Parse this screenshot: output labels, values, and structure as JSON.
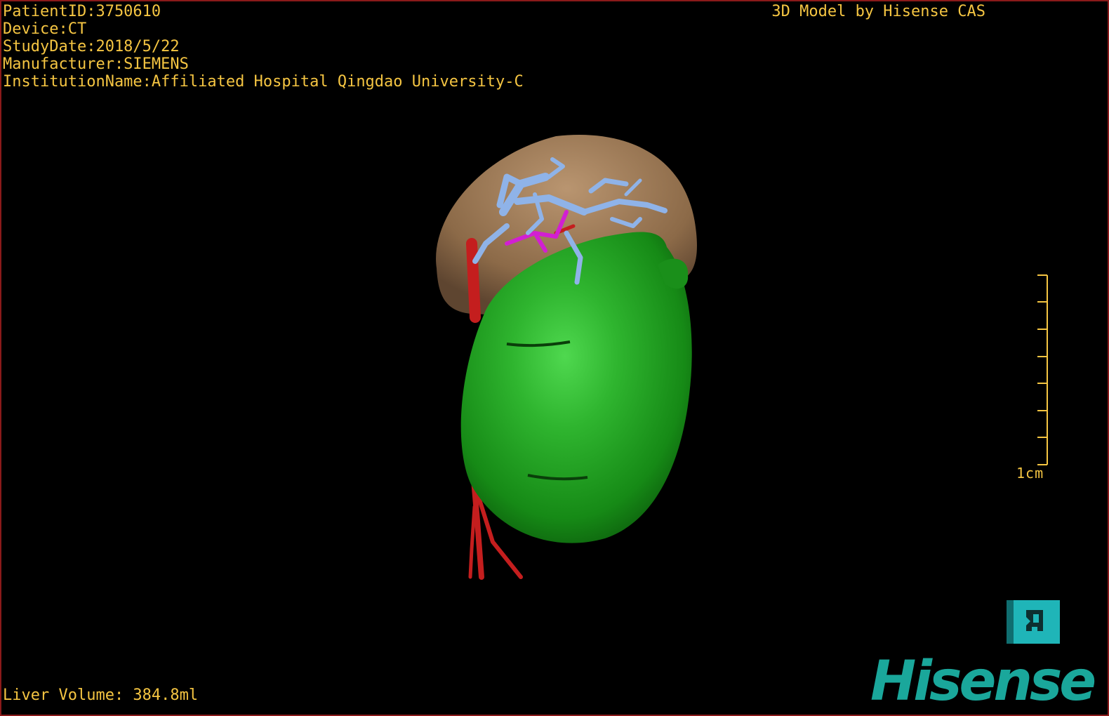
{
  "info": {
    "patient_id": "PatientID:3750610",
    "device": "Device:CT",
    "study_date": "StudyDate:2018/5/22",
    "manufacturer": "Manufacturer:SIEMENS",
    "institution": "InstitutionName:Affiliated Hospital Qingdao University-C"
  },
  "model_credit": "3D Model by Hisense CAS",
  "volume_readout": "Liver Volume: 384.8ml",
  "scale": {
    "label": "1cm"
  },
  "brand": {
    "logo_text": "Hisense"
  },
  "colors": {
    "overlay_text": "#f5c542",
    "border": "#8b1a1a",
    "liver": "#1e9e1e",
    "liver_highlight": "#4fd84f",
    "organ_backdrop": "#c9a57e",
    "portal_vein": "#8fb3e8",
    "hepatic_artery": "#c41e1e",
    "bile_duct": "#d21fd2",
    "brand": "#1aa79b",
    "app_button": "#1fb5b8"
  },
  "icons": {
    "app_button_icon": "cas-app-icon"
  }
}
